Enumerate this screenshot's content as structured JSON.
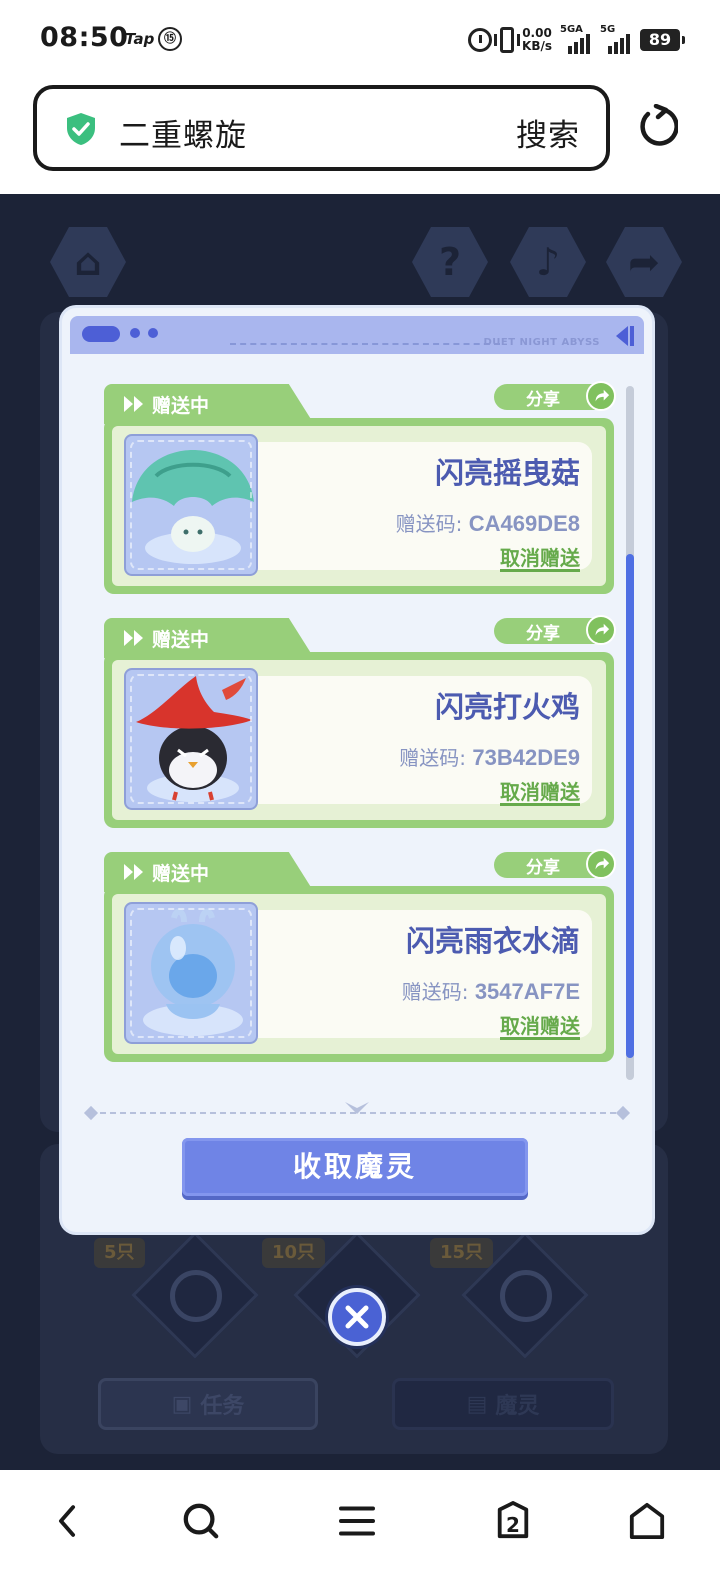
{
  "status_bar": {
    "time": "08:50",
    "tap_label": "Tap",
    "speed_top": "0.00",
    "speed_unit": "KB/s",
    "net1": "5GA",
    "net2": "5G",
    "battery": "89"
  },
  "browser": {
    "query": "二重螺旋",
    "search_label": "搜索"
  },
  "game_bg": {
    "count_tags": [
      "5只",
      "10只",
      "15只"
    ],
    "task_label": "任务",
    "spirit_label": "魔灵"
  },
  "modal": {
    "header_title": "DUET NIGHT ABYSS",
    "code_prefix": "赠送码: ",
    "cards": [
      {
        "status": "赠送中",
        "share": "分享",
        "name": "闪亮摇曳菇",
        "code": "CA469DE8",
        "cancel": "取消赠送"
      },
      {
        "status": "赠送中",
        "share": "分享",
        "name": "闪亮打火鸡",
        "code": "73B42DE9",
        "cancel": "取消赠送"
      },
      {
        "status": "赠送中",
        "share": "分享",
        "name": "闪亮雨衣水滴",
        "code": "3547AF7E",
        "cancel": "取消赠送"
      }
    ],
    "collect_button": "收取魔灵"
  },
  "bottom_nav": {
    "tab_count": "2"
  },
  "colors": {
    "accent_blue": "#6f84e6",
    "card_green": "#98cf7a",
    "name_blue": "#4c5bb0",
    "shield_green": "#3bbf7f"
  }
}
